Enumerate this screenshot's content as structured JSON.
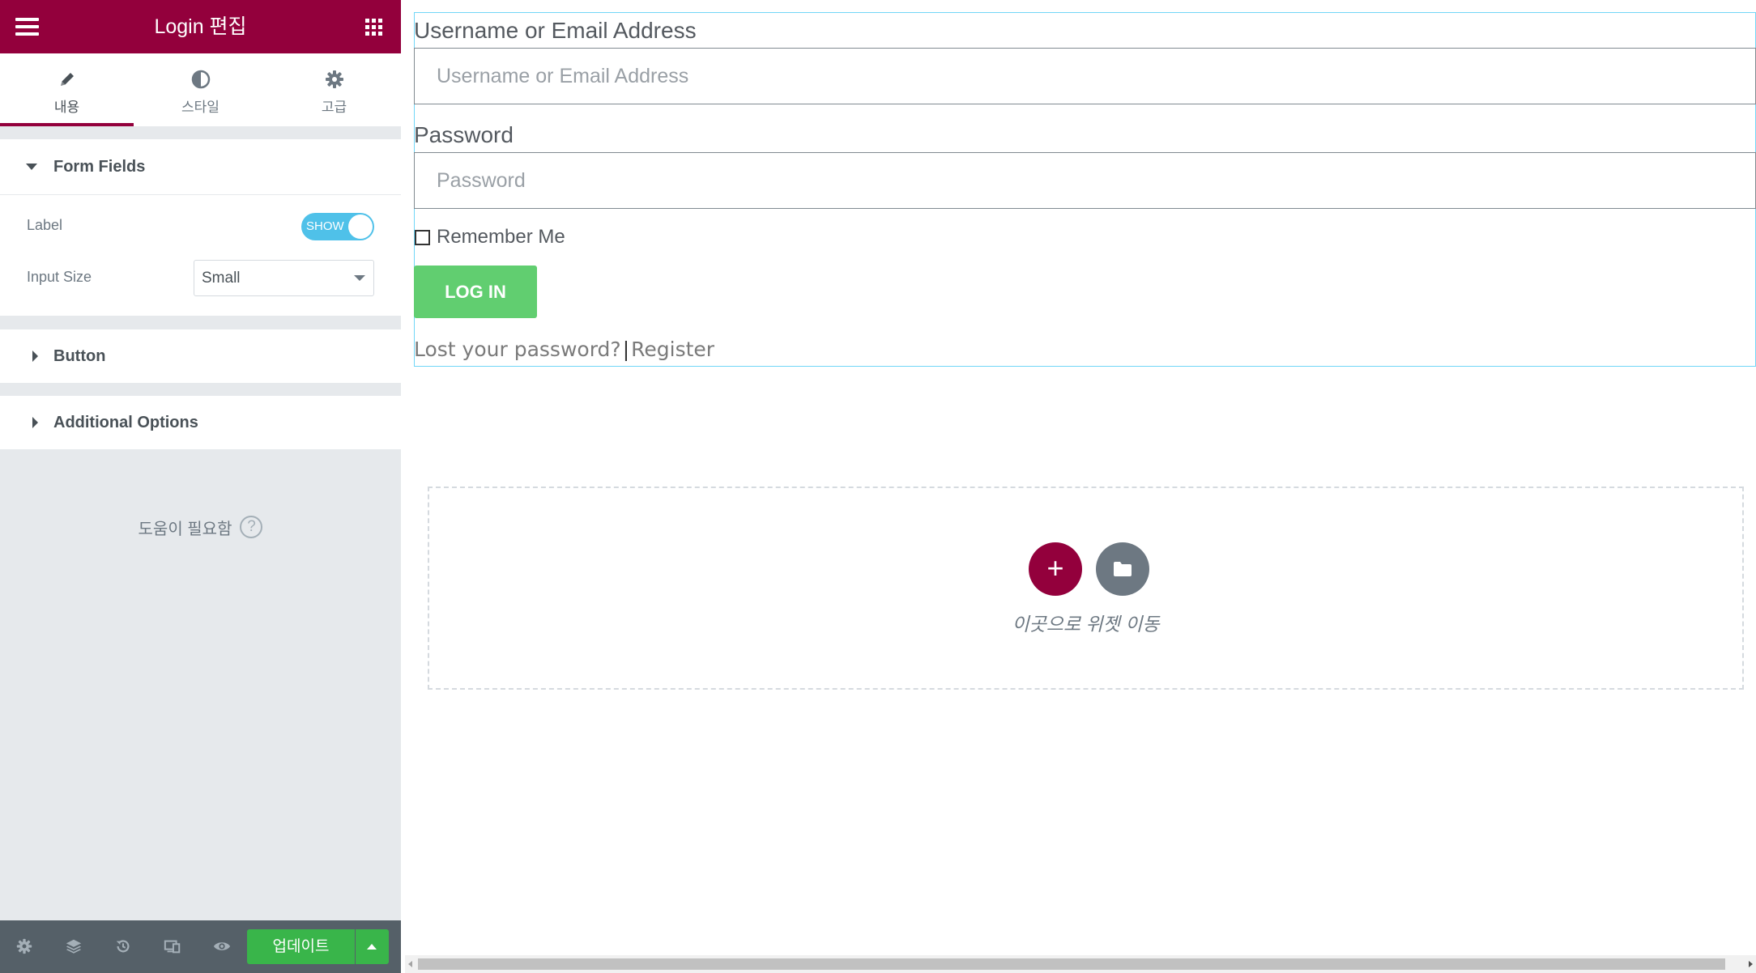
{
  "panel": {
    "title": "Login 편집",
    "menu_icon": "hamburger-icon",
    "apps_icon": "grid-icon",
    "tabs": [
      {
        "label": "내용",
        "icon": "pencil-icon",
        "active": true
      },
      {
        "label": "스타일",
        "icon": "contrast-icon",
        "active": false
      },
      {
        "label": "고급",
        "icon": "gear-icon",
        "active": false
      }
    ],
    "sections": {
      "form_fields": {
        "title": "Form Fields",
        "label_control": {
          "label": "Label",
          "toggle_text": "SHOW",
          "enabled": true
        },
        "input_size": {
          "label": "Input Size",
          "value": "Small"
        }
      },
      "button": {
        "title": "Button"
      },
      "additional_options": {
        "title": "Additional Options"
      }
    },
    "help": {
      "text": "도움이 필요함",
      "icon": "question-icon"
    },
    "footer": {
      "icons": [
        "settings-icon",
        "layers-icon",
        "history-icon",
        "responsive-icon",
        "eye-icon"
      ],
      "update_label": "업데이트"
    }
  },
  "preview": {
    "username": {
      "label": "Username or Email Address",
      "placeholder": "Username or Email Address"
    },
    "password": {
      "label": "Password",
      "placeholder": "Password"
    },
    "remember_me": "Remember Me",
    "login_button": "LOG IN",
    "lost_password": "Lost your password?",
    "separator": "|",
    "register": "Register",
    "dropzone": {
      "text": "이곳으로 위젯 이동",
      "add_icon": "plus-icon",
      "library_icon": "folder-icon"
    }
  },
  "colors": {
    "brand": "#93003c",
    "toggle_on": "#4fc1e9",
    "update_green": "#39b54a",
    "login_button": "#61ce70",
    "widget_outline": "#71d7f7"
  }
}
